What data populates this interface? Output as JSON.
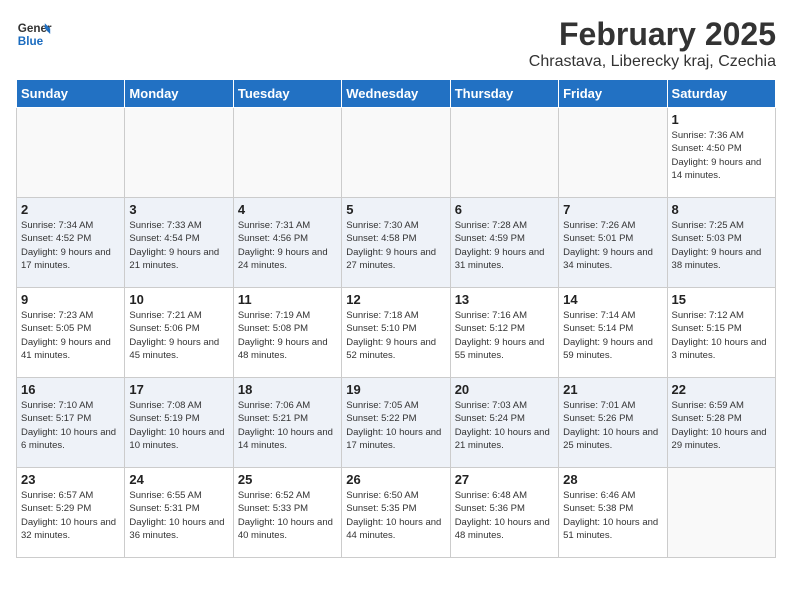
{
  "logo": {
    "text_general": "General",
    "text_blue": "Blue"
  },
  "header": {
    "month": "February 2025",
    "location": "Chrastava, Liberecky kraj, Czechia"
  },
  "weekdays": [
    "Sunday",
    "Monday",
    "Tuesday",
    "Wednesday",
    "Thursday",
    "Friday",
    "Saturday"
  ],
  "weeks": [
    [
      {
        "day": "",
        "info": ""
      },
      {
        "day": "",
        "info": ""
      },
      {
        "day": "",
        "info": ""
      },
      {
        "day": "",
        "info": ""
      },
      {
        "day": "",
        "info": ""
      },
      {
        "day": "",
        "info": ""
      },
      {
        "day": "1",
        "info": "Sunrise: 7:36 AM\nSunset: 4:50 PM\nDaylight: 9 hours and 14 minutes."
      }
    ],
    [
      {
        "day": "2",
        "info": "Sunrise: 7:34 AM\nSunset: 4:52 PM\nDaylight: 9 hours and 17 minutes."
      },
      {
        "day": "3",
        "info": "Sunrise: 7:33 AM\nSunset: 4:54 PM\nDaylight: 9 hours and 21 minutes."
      },
      {
        "day": "4",
        "info": "Sunrise: 7:31 AM\nSunset: 4:56 PM\nDaylight: 9 hours and 24 minutes."
      },
      {
        "day": "5",
        "info": "Sunrise: 7:30 AM\nSunset: 4:58 PM\nDaylight: 9 hours and 27 minutes."
      },
      {
        "day": "6",
        "info": "Sunrise: 7:28 AM\nSunset: 4:59 PM\nDaylight: 9 hours and 31 minutes."
      },
      {
        "day": "7",
        "info": "Sunrise: 7:26 AM\nSunset: 5:01 PM\nDaylight: 9 hours and 34 minutes."
      },
      {
        "day": "8",
        "info": "Sunrise: 7:25 AM\nSunset: 5:03 PM\nDaylight: 9 hours and 38 minutes."
      }
    ],
    [
      {
        "day": "9",
        "info": "Sunrise: 7:23 AM\nSunset: 5:05 PM\nDaylight: 9 hours and 41 minutes."
      },
      {
        "day": "10",
        "info": "Sunrise: 7:21 AM\nSunset: 5:06 PM\nDaylight: 9 hours and 45 minutes."
      },
      {
        "day": "11",
        "info": "Sunrise: 7:19 AM\nSunset: 5:08 PM\nDaylight: 9 hours and 48 minutes."
      },
      {
        "day": "12",
        "info": "Sunrise: 7:18 AM\nSunset: 5:10 PM\nDaylight: 9 hours and 52 minutes."
      },
      {
        "day": "13",
        "info": "Sunrise: 7:16 AM\nSunset: 5:12 PM\nDaylight: 9 hours and 55 minutes."
      },
      {
        "day": "14",
        "info": "Sunrise: 7:14 AM\nSunset: 5:14 PM\nDaylight: 9 hours and 59 minutes."
      },
      {
        "day": "15",
        "info": "Sunrise: 7:12 AM\nSunset: 5:15 PM\nDaylight: 10 hours and 3 minutes."
      }
    ],
    [
      {
        "day": "16",
        "info": "Sunrise: 7:10 AM\nSunset: 5:17 PM\nDaylight: 10 hours and 6 minutes."
      },
      {
        "day": "17",
        "info": "Sunrise: 7:08 AM\nSunset: 5:19 PM\nDaylight: 10 hours and 10 minutes."
      },
      {
        "day": "18",
        "info": "Sunrise: 7:06 AM\nSunset: 5:21 PM\nDaylight: 10 hours and 14 minutes."
      },
      {
        "day": "19",
        "info": "Sunrise: 7:05 AM\nSunset: 5:22 PM\nDaylight: 10 hours and 17 minutes."
      },
      {
        "day": "20",
        "info": "Sunrise: 7:03 AM\nSunset: 5:24 PM\nDaylight: 10 hours and 21 minutes."
      },
      {
        "day": "21",
        "info": "Sunrise: 7:01 AM\nSunset: 5:26 PM\nDaylight: 10 hours and 25 minutes."
      },
      {
        "day": "22",
        "info": "Sunrise: 6:59 AM\nSunset: 5:28 PM\nDaylight: 10 hours and 29 minutes."
      }
    ],
    [
      {
        "day": "23",
        "info": "Sunrise: 6:57 AM\nSunset: 5:29 PM\nDaylight: 10 hours and 32 minutes."
      },
      {
        "day": "24",
        "info": "Sunrise: 6:55 AM\nSunset: 5:31 PM\nDaylight: 10 hours and 36 minutes."
      },
      {
        "day": "25",
        "info": "Sunrise: 6:52 AM\nSunset: 5:33 PM\nDaylight: 10 hours and 40 minutes."
      },
      {
        "day": "26",
        "info": "Sunrise: 6:50 AM\nSunset: 5:35 PM\nDaylight: 10 hours and 44 minutes."
      },
      {
        "day": "27",
        "info": "Sunrise: 6:48 AM\nSunset: 5:36 PM\nDaylight: 10 hours and 48 minutes."
      },
      {
        "day": "28",
        "info": "Sunrise: 6:46 AM\nSunset: 5:38 PM\nDaylight: 10 hours and 51 minutes."
      },
      {
        "day": "",
        "info": ""
      }
    ]
  ]
}
